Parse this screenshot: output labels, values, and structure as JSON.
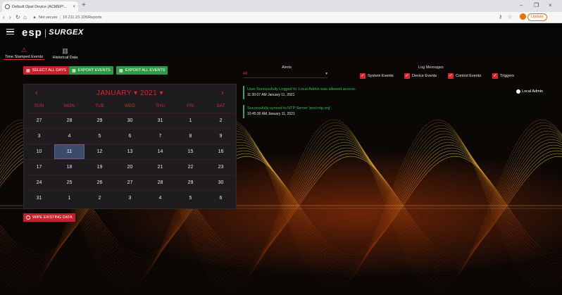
{
  "browser": {
    "tab_title": "Default Opal Device (ACMEP!...",
    "tab_close": "×",
    "new_tab": "+",
    "window_controls": {
      "minimize": "–",
      "restore": "❐",
      "close": "×"
    },
    "nav": {
      "back": "‹",
      "forward": "›",
      "reload": "↻",
      "home": "⌂"
    },
    "security_label": "Not secure",
    "url": "10.211.23.105/Reports",
    "update_label": "Update"
  },
  "header": {
    "logo_esp": "esp",
    "logo_separator": "|",
    "logo_surgex": "SURGEX"
  },
  "nav_tabs": [
    {
      "label": "Time Stamped Events",
      "icon": "alert-icon",
      "active": true
    },
    {
      "label": "Historical Data",
      "icon": "bar-chart-icon",
      "active": false
    }
  ],
  "actions": {
    "select_all_days": "SELECT ALL DAYS",
    "export_events": "EXPORT EVENTS",
    "export_all_events": "EXPORT ALL EVENTS",
    "wipe_existing_data": "WIPE EXISTING DATA"
  },
  "filters": {
    "alerts_label": "Alerts",
    "alerts_value": "All",
    "log_messages_label": "Log Messages",
    "checkboxes": [
      {
        "label": "System Events",
        "checked": true
      },
      {
        "label": "Device Events",
        "checked": true
      },
      {
        "label": "Control Events",
        "checked": true
      },
      {
        "label": "Triggers",
        "checked": true
      }
    ]
  },
  "calendar": {
    "month": "JANUARY",
    "year": "2021",
    "prev": "‹",
    "next": "›",
    "weekdays": [
      "SUN",
      "MON",
      "TUE",
      "WED",
      "THU",
      "FRI",
      "SAT"
    ],
    "weeks": [
      [
        "27",
        "28",
        "29",
        "30",
        "31",
        "1",
        "2"
      ],
      [
        "3",
        "4",
        "5",
        "6",
        "7",
        "8",
        "9"
      ],
      [
        "10",
        "11",
        "12",
        "13",
        "14",
        "15",
        "16"
      ],
      [
        "17",
        "18",
        "19",
        "20",
        "21",
        "22",
        "23"
      ],
      [
        "24",
        "25",
        "26",
        "27",
        "28",
        "29",
        "30"
      ],
      [
        "31",
        "1",
        "2",
        "3",
        "4",
        "5",
        "6"
      ]
    ],
    "selected_day": "11"
  },
  "events": [
    {
      "message": "User Successfully Logged In: Local Admin was allowed access.",
      "timestamp": "11:30:07 AM January 11, 2021",
      "user": "Local Admin"
    },
    {
      "message": "Successfully synced to NTP Server 'pool.ntp.org'.",
      "timestamp": "10:45:30 AM January 11, 2021",
      "user": ""
    }
  ],
  "colors": {
    "accent_red": "#d8262f",
    "accent_green": "#2f9a45",
    "event_text_green": "#3cbf55",
    "selected_day_bg": "#3d4b6b"
  }
}
